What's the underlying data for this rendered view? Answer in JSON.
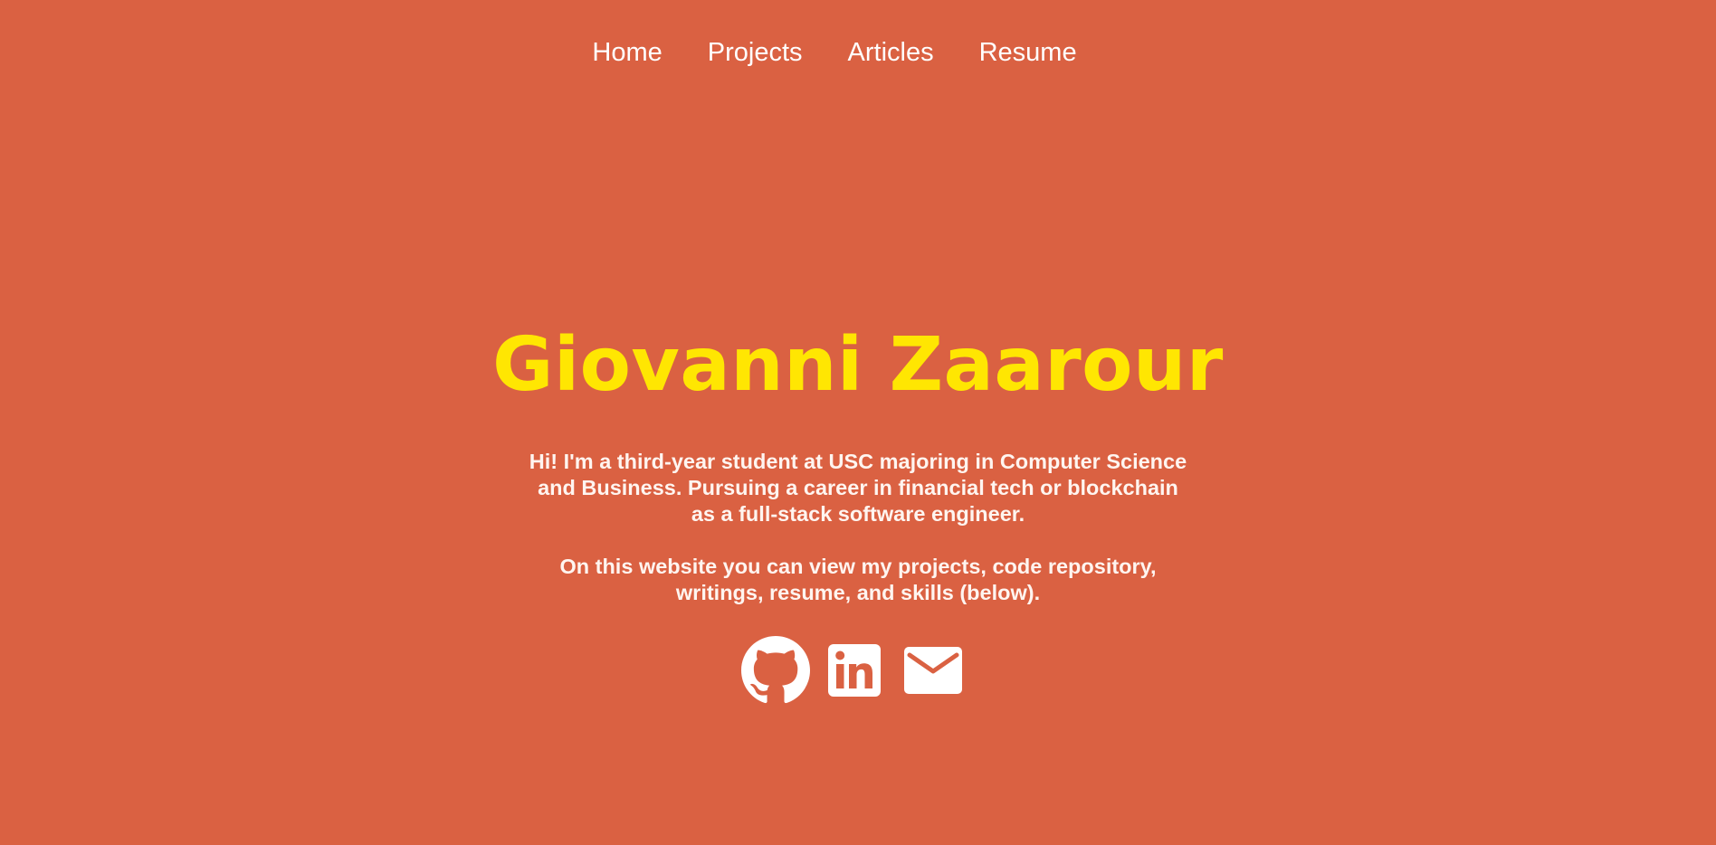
{
  "nav": {
    "items": [
      {
        "label": "Home"
      },
      {
        "label": "Projects"
      },
      {
        "label": "Articles"
      },
      {
        "label": "Resume"
      }
    ]
  },
  "hero": {
    "name": "Giovanni Zaarour",
    "bio_paragraph_1": "Hi! I'm a third-year student at USC majoring in Computer Science and Business. Pursuing a career in financial tech or blockchain as a full-stack software engineer.",
    "bio_paragraph_2": "On this website you can view my projects, code repository, writings, resume, and skills (below)."
  },
  "social": {
    "icons": [
      "github-icon",
      "linkedin-icon",
      "email-icon"
    ]
  },
  "colors": {
    "background": "#da6142",
    "name": "#ffe602",
    "text": "#ffffff"
  }
}
